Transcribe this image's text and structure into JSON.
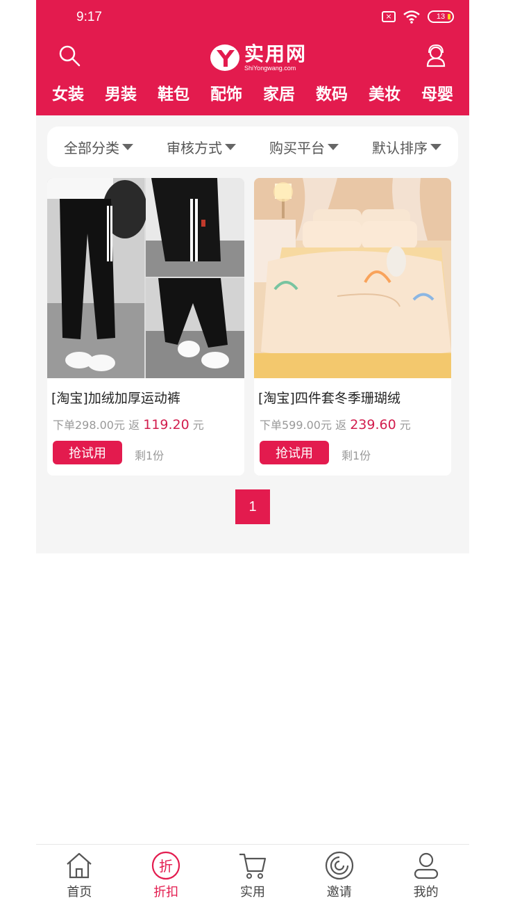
{
  "status_bar": {
    "time": "9:17",
    "battery": "13"
  },
  "header": {
    "logo_cn": "实用网",
    "logo_en": "ShiYongwang.com",
    "brand_color": "#e31b4e",
    "categories": [
      "女装",
      "男装",
      "鞋包",
      "配饰",
      "家居",
      "数码",
      "美妆",
      "母婴"
    ]
  },
  "filters": [
    "全部分类",
    "审核方式",
    "购买平台",
    "默认排序"
  ],
  "products": [
    {
      "title": "[淘宝]加绒加厚运动裤",
      "order_label": "下单298.00元",
      "rebate_prefix": "返",
      "rebate_value": "119.20",
      "rebate_unit": "元",
      "button": "抢试用",
      "remaining": "剩1份"
    },
    {
      "title": "[淘宝]四件套冬季珊瑚绒",
      "order_label": "下单599.00元",
      "rebate_prefix": "返",
      "rebate_value": "239.60",
      "rebate_unit": "元",
      "button": "抢试用",
      "remaining": "剩1份"
    }
  ],
  "pagination": {
    "current": "1"
  },
  "tabbar": [
    {
      "label": "首页",
      "icon": "home-icon"
    },
    {
      "label": "折扣",
      "icon": "discount-icon",
      "glyph": "折"
    },
    {
      "label": "实用",
      "icon": "cart-icon"
    },
    {
      "label": "邀请",
      "icon": "invite-icon"
    },
    {
      "label": "我的",
      "icon": "user-icon"
    }
  ]
}
